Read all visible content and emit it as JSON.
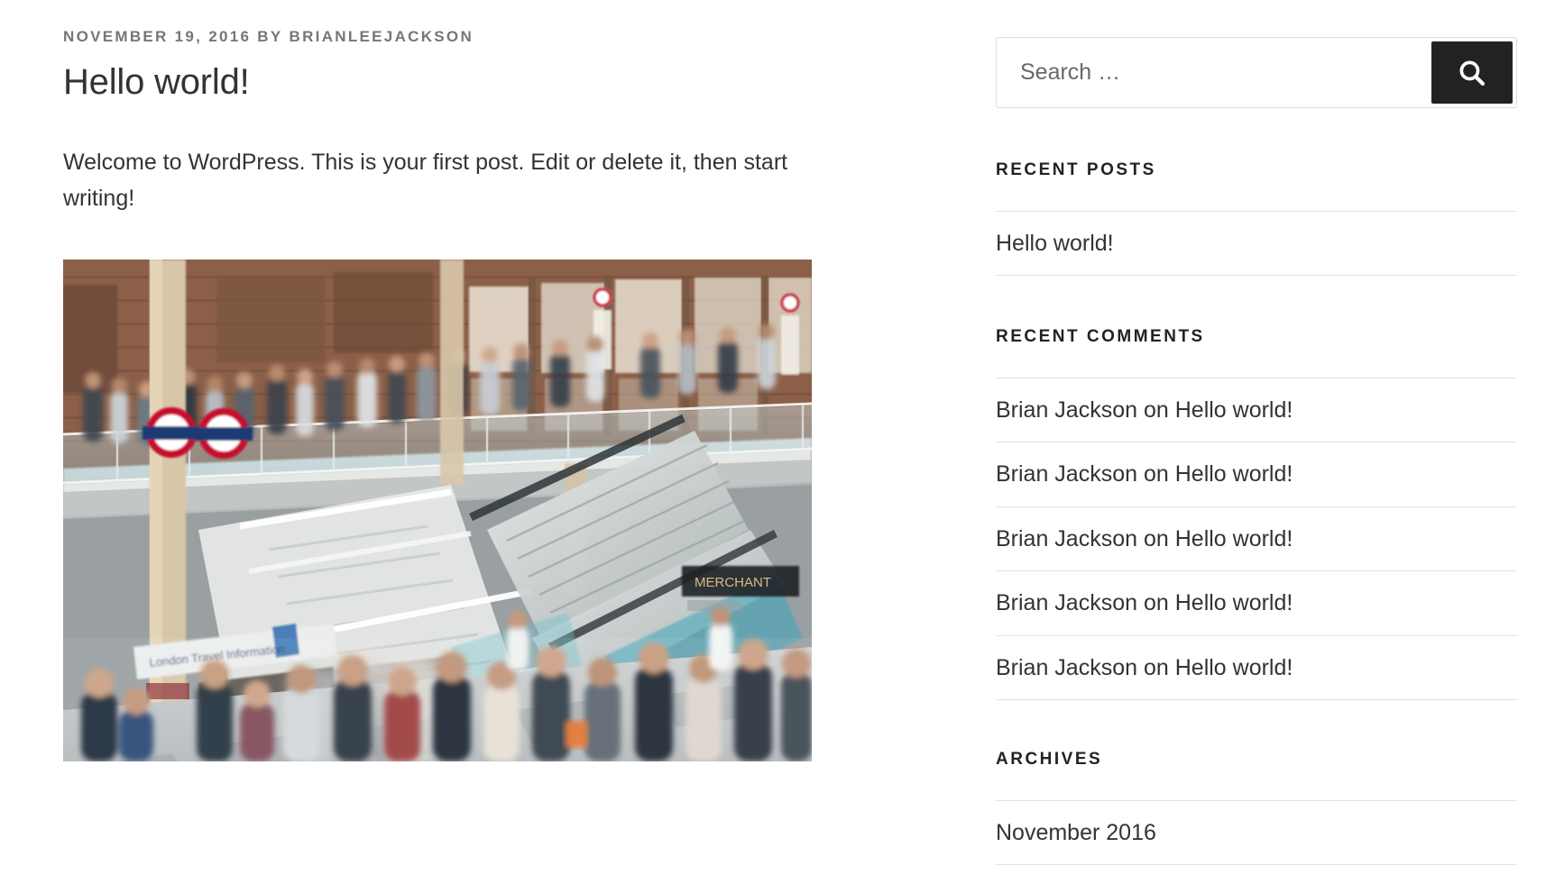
{
  "post": {
    "meta": {
      "date": "NOVEMBER 19, 2016",
      "by": "BY",
      "author": "BRIANLEEJACKSON",
      "full": "NOVEMBER 19, 2016 BY BRIANLEEJACKSON"
    },
    "title": "Hello world!",
    "body": "Welcome to WordPress. This is your first post. Edit or delete it, then start writing!",
    "featured_image_alt": "Busy London railway station concourse with escalators, staircases and blurred crowds of commuters"
  },
  "sidebar": {
    "search": {
      "placeholder": "Search …",
      "value": "",
      "button_icon": "search-icon",
      "button_color": "#222222"
    },
    "recent_posts": {
      "title": "RECENT POSTS",
      "items": [
        {
          "label": "Hello world!"
        }
      ]
    },
    "recent_comments": {
      "title": "RECENT COMMENTS",
      "items": [
        {
          "author": "Brian Jackson",
          "connector": " on ",
          "post": "Hello world!"
        },
        {
          "author": "Brian Jackson",
          "connector": " on ",
          "post": "Hello world!"
        },
        {
          "author": "Brian Jackson",
          "connector": " on ",
          "post": "Hello world!"
        },
        {
          "author": "Brian Jackson",
          "connector": " on ",
          "post": "Hello world!"
        },
        {
          "author": "Brian Jackson",
          "connector": " on ",
          "post": "Hello world!"
        }
      ]
    },
    "archives": {
      "title": "ARCHIVES",
      "items": [
        {
          "label": "November 2016"
        }
      ]
    }
  },
  "colors": {
    "text": "#333333",
    "meta": "#767676",
    "heading": "#222222",
    "rule": "#e2e2e2",
    "button": "#222222",
    "background": "#ffffff"
  }
}
